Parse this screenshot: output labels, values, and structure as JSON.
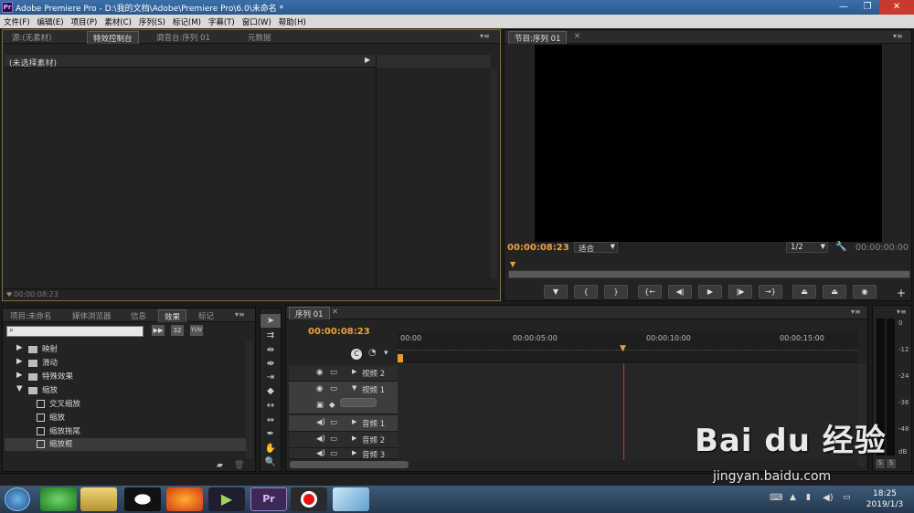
{
  "titlebar": {
    "app_icon": "Pr",
    "title": "Adobe Premiere Pro - D:\\我的文档\\Adobe\\Premiere Pro\\6.0\\未命名 *",
    "minimize": "—",
    "maximize": "❐",
    "close": "✕"
  },
  "menu": [
    "文件(F)",
    "编辑(E)",
    "项目(P)",
    "素材(C)",
    "序列(S)",
    "标记(M)",
    "字幕(T)",
    "窗口(W)",
    "帮助(H)"
  ],
  "source_panel": {
    "tabs": [
      "源:(无素材)",
      "特效控制台",
      "调音台:序列 01",
      "元数据"
    ],
    "empty_label": "(未选择素材)",
    "timecode": "00:00:08:23"
  },
  "program_panel": {
    "tab": "节目:序列 01",
    "timecode": "00:00:08:23",
    "fit": "适合",
    "ratio": "1/2",
    "duration": "00:00:00:00"
  },
  "project_panel": {
    "tabs": [
      "项目:未命名",
      "媒体浏览器",
      "信息",
      "效果",
      "标记"
    ],
    "search_placeholder": "",
    "badges": [
      "32",
      "YUV"
    ],
    "tree": [
      {
        "label": "映射",
        "type": "folder",
        "expanded": false
      },
      {
        "label": "滑动",
        "type": "folder",
        "expanded": false
      },
      {
        "label": "特殊效果",
        "type": "folder",
        "expanded": false
      },
      {
        "label": "缩放",
        "type": "folder",
        "expanded": true
      },
      {
        "label": "交叉缩放",
        "type": "effect"
      },
      {
        "label": "缩放",
        "type": "effect"
      },
      {
        "label": "缩放拖尾",
        "type": "effect"
      },
      {
        "label": "缩放框",
        "type": "effect",
        "selected": true
      }
    ]
  },
  "timeline": {
    "tab": "序列 01",
    "timecode": "00:00:08:23",
    "ruler": [
      "00:00",
      "00:00:05:00",
      "00:00:10:00",
      "00:00:15:00"
    ],
    "tracks": [
      "视频 2",
      "视频 1",
      "音频 1",
      "音频 2",
      "音频 3"
    ],
    "playhead_fraction": 0.49
  },
  "audio_meter": {
    "labels": [
      "0",
      "-12",
      "-24",
      "-36",
      "-48",
      "dB"
    ],
    "solo": [
      "S",
      "S"
    ]
  },
  "taskbar": {
    "time": "18:25",
    "date": "2019/1/3"
  },
  "watermark": {
    "text": "Bai du 经验",
    "url": "jingyan.baidu.com"
  }
}
